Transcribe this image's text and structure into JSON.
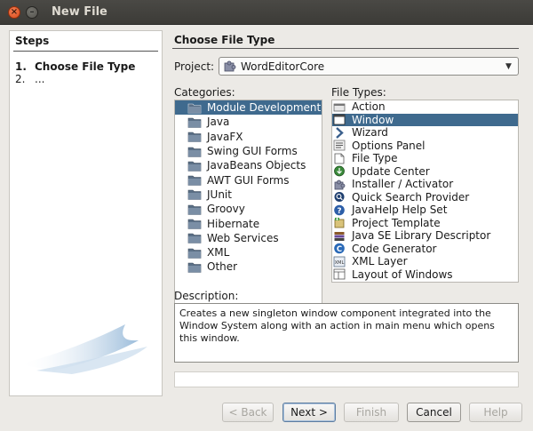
{
  "window": {
    "title": "New File",
    "close_glyph": "×",
    "minimize_glyph": "–"
  },
  "steps": {
    "title": "Steps",
    "items": [
      {
        "num": "1.",
        "label": "Choose File Type"
      },
      {
        "num": "2.",
        "label": "..."
      }
    ]
  },
  "panel": {
    "title": "Choose File Type",
    "project_label": "Project:",
    "project_value": "WordEditorCore",
    "categories_label": "Categories:",
    "file_types_label": "File Types:",
    "description_label": "Description:"
  },
  "categories": [
    {
      "label": "Module Development",
      "icon": "folder-icon",
      "selected": true
    },
    {
      "label": "Java",
      "icon": "folder-icon"
    },
    {
      "label": "JavaFX",
      "icon": "folder-icon"
    },
    {
      "label": "Swing GUI Forms",
      "icon": "folder-icon"
    },
    {
      "label": "JavaBeans Objects",
      "icon": "folder-icon"
    },
    {
      "label": "AWT GUI Forms",
      "icon": "folder-icon"
    },
    {
      "label": "JUnit",
      "icon": "folder-icon"
    },
    {
      "label": "Groovy",
      "icon": "folder-icon"
    },
    {
      "label": "Hibernate",
      "icon": "folder-icon"
    },
    {
      "label": "Web Services",
      "icon": "folder-icon"
    },
    {
      "label": "XML",
      "icon": "folder-icon"
    },
    {
      "label": "Other",
      "icon": "folder-icon"
    }
  ],
  "file_types": [
    {
      "label": "Action",
      "icon": "action-icon"
    },
    {
      "label": "Window",
      "icon": "window-icon",
      "selected": true
    },
    {
      "label": "Wizard",
      "icon": "wizard-icon"
    },
    {
      "label": "Options Panel",
      "icon": "options-panel-icon"
    },
    {
      "label": "File Type",
      "icon": "file-type-icon"
    },
    {
      "label": "Update Center",
      "icon": "update-center-icon"
    },
    {
      "label": "Installer / Activator",
      "icon": "installer-icon"
    },
    {
      "label": "Quick Search Provider",
      "icon": "quick-search-icon"
    },
    {
      "label": "JavaHelp Help Set",
      "icon": "help-icon"
    },
    {
      "label": "Project Template",
      "icon": "project-template-icon"
    },
    {
      "label": "Java SE Library Descriptor",
      "icon": "library-icon"
    },
    {
      "label": "Code Generator",
      "icon": "code-generator-icon"
    },
    {
      "label": "XML Layer",
      "icon": "xml-layer-icon"
    },
    {
      "label": "Layout of Windows",
      "icon": "layout-icon"
    }
  ],
  "description": "Creates a new singleton window component integrated into the Window System along with an action in main menu which opens this window.",
  "buttons": {
    "back": "< Back",
    "next": "Next >",
    "finish": "Finish",
    "cancel": "Cancel",
    "help": "Help"
  },
  "colors": {
    "selection": "#3f6a8e",
    "titlebar": "#3c3b37",
    "dialog_bg": "#eceae6"
  }
}
